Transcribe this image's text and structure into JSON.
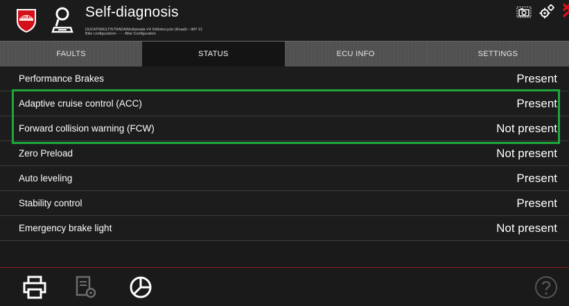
{
  "header": {
    "title": "Self-diagnosis",
    "path_line1": "DUCATI\\MULTISTRADA\\Multistrada V4 S\\Motorcycle (Road)\\---\\MY 21",
    "path_line2": "Bike configuration\\- - - - Bike Configuration",
    "logo_text": "DUCATI"
  },
  "tabs": [
    {
      "label": "FAULTS",
      "active": false
    },
    {
      "label": "STATUS",
      "active": true
    },
    {
      "label": "ECU INFO",
      "active": false
    },
    {
      "label": "SETTINGS",
      "active": false
    }
  ],
  "rows": [
    {
      "label": "Performance Brakes",
      "value": "Present"
    },
    {
      "label": "Adaptive cruise control (ACC)",
      "value": "Present"
    },
    {
      "label": "Forward collision warning (FCW)",
      "value": "Not present"
    },
    {
      "label": "Zero Preload",
      "value": "Not present"
    },
    {
      "label": "Auto leveling",
      "value": "Present"
    },
    {
      "label": "Stability control",
      "value": "Present"
    },
    {
      "label": "Emergency brake light",
      "value": "Not present"
    }
  ],
  "colors": {
    "accent_red": "#d4111a",
    "highlight_green": "#1fa83a",
    "background": "#1a1a1a"
  },
  "icons": {
    "header": [
      "user-icon",
      "camera-icon",
      "gear-icon",
      "close-icon"
    ],
    "footer": [
      "print-icon",
      "document-settings-icon",
      "pie-chart-icon",
      "help-icon"
    ]
  }
}
